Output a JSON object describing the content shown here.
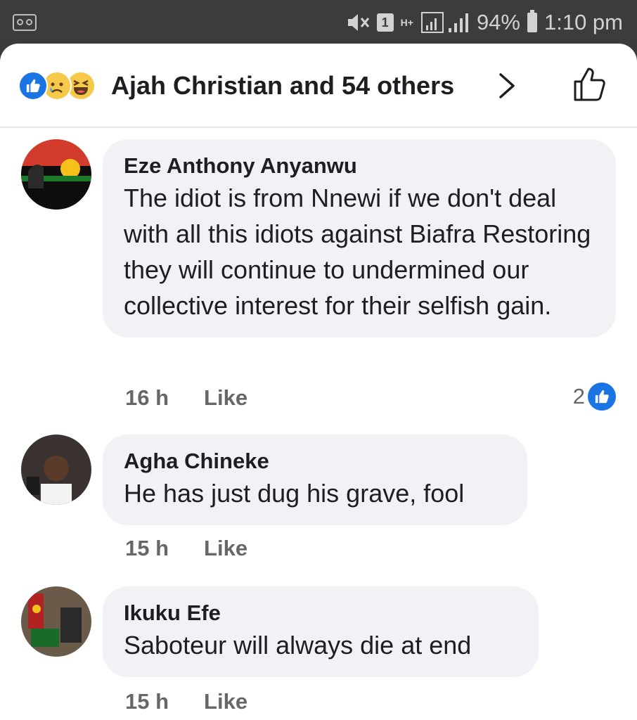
{
  "status_bar": {
    "battery": "94%",
    "time": "1:10 pm",
    "network_label": "H+",
    "sim_badge": "1"
  },
  "reactions": {
    "summary": "Ajah Christian and 54 others",
    "icons": [
      "like-icon",
      "sad-icon",
      "haha-icon"
    ],
    "like_button_icon": "thumbs-up-outline-icon"
  },
  "comments": [
    {
      "author": "Eze Anthony Anyanwu",
      "text": "The idiot is from Nnewi if we don't deal with all this  idiots against Biafra Restoring they will continue to undermined our collective interest for their selfish gain.",
      "time": "16 h",
      "like_label": "Like",
      "like_count": "2"
    },
    {
      "author": "Agha Chineke",
      "text": "He has just dug his grave, fool",
      "time": "15 h",
      "like_label": "Like"
    },
    {
      "author": "Ikuku Efe",
      "text": "Saboteur will always die at end",
      "time": "15 h",
      "like_label": "Like"
    }
  ],
  "colors": {
    "accent_blue": "#1b74e4",
    "bubble_bg": "#f0f2f5",
    "meta_gray": "#65676b",
    "status_bar_bg": "#3c3c3c"
  }
}
